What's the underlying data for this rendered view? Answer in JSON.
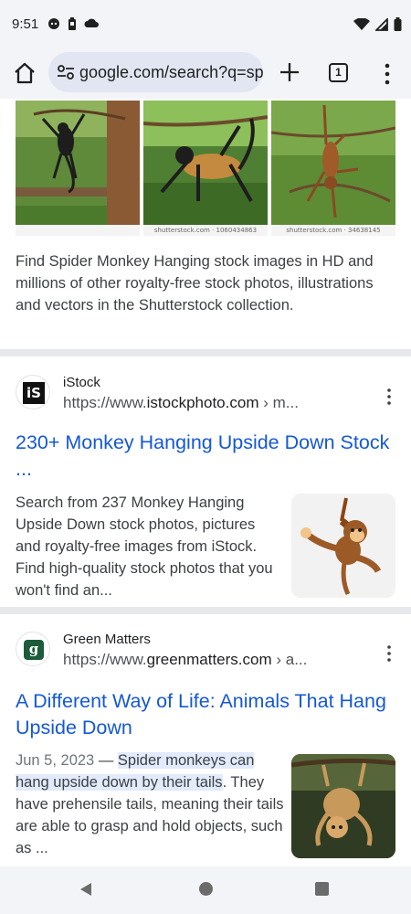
{
  "status_bar": {
    "time": "9:51",
    "left_icons": [
      "chat-icon",
      "battery-saver-icon",
      "cloud-icon"
    ],
    "right_icons": [
      "wifi-icon",
      "signal-icon",
      "battery-icon"
    ]
  },
  "toolbar": {
    "url": "google.com/search?q=sp",
    "tab_count": "1"
  },
  "image_strip": {
    "captions": [
      "",
      "shutterstock.com · 1060434863",
      "shutterstock.com · 34638145"
    ]
  },
  "snippet_top": "Find Spider Monkey Hanging stock images in HD and millions of other royalty-free stock photos, illustrations and vectors in the Shutterstock collection.",
  "results": [
    {
      "site_name": "iStock",
      "url_prefix": "https://www.",
      "url_domain": "istockphoto.com",
      "url_suffix": " › m...",
      "favicon_text": "iS",
      "title_line1": "230+ Monkey Hanging Upside Down Stock",
      "title_line2": "...",
      "body": "Search from 237 Monkey Hanging Upside Down stock photos, pictures and royalty-free images from iStock. Find high-quality stock photos that you won't find an..."
    },
    {
      "site_name": "Green Matters",
      "url_prefix": "https://www.",
      "url_domain": "greenmatters.com",
      "url_suffix": " › a...",
      "favicon_text": "g",
      "title_line1": "A Different Way of Life: Animals That Hang",
      "title_line2": "Upside Down",
      "date": "Jun 5, 2023",
      "dash": " — ",
      "highlight_a": "Spider monkeys can",
      "highlight_b": "hang upside down by their tails",
      "body_rest": ". They have prehensile tails, meaning their tails are able to grasp and hold objects, such as ..."
    }
  ],
  "colors": {
    "link_blue": "#1558d6",
    "chrome_bg": "#f3f4f8",
    "omnibox_bg": "#e1e6f2",
    "highlight": "#e2ebfc",
    "greenmatters": "#1d5c3a"
  }
}
